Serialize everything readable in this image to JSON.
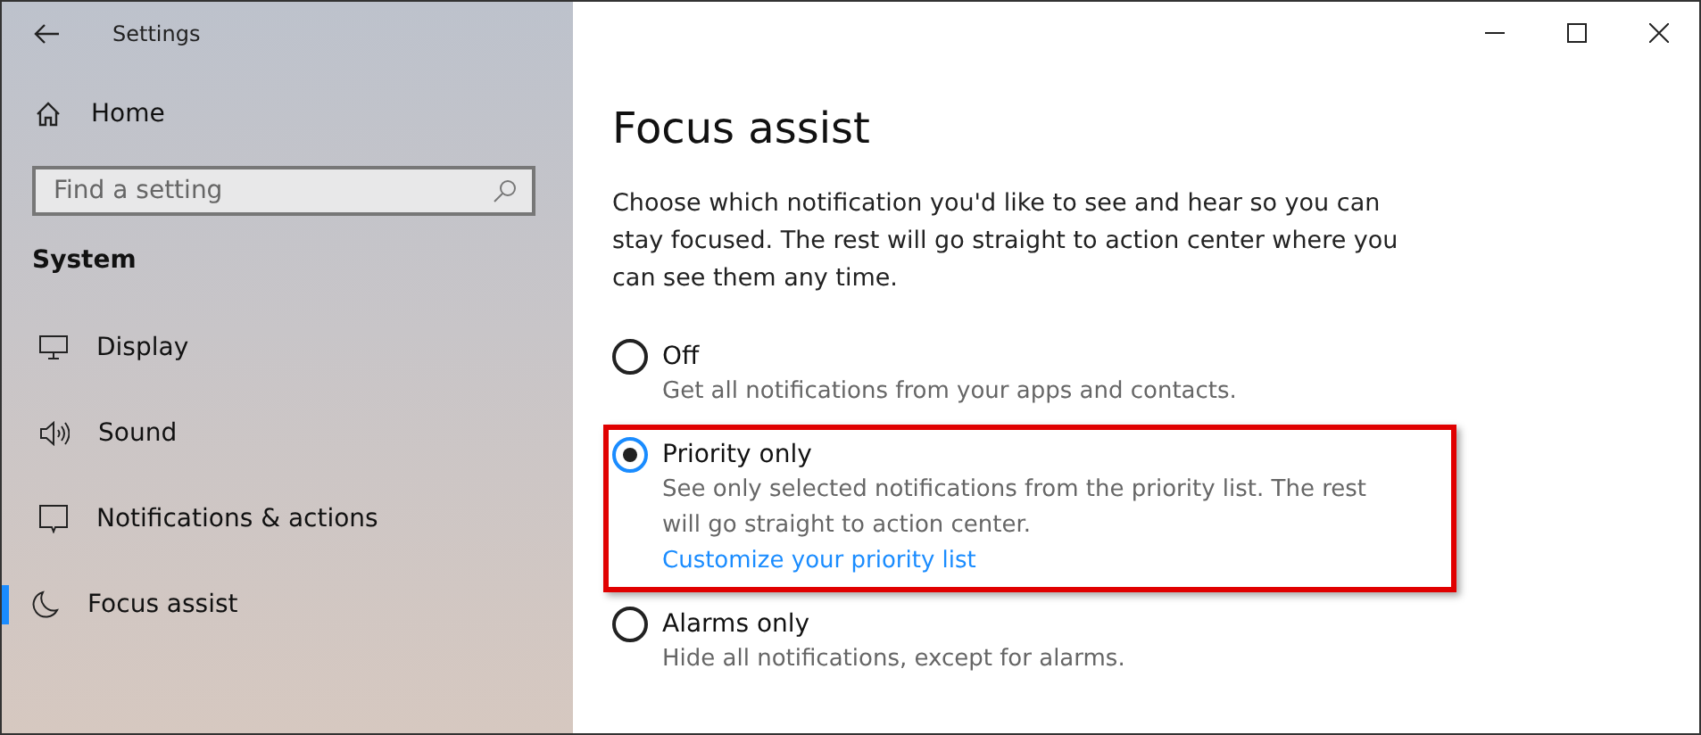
{
  "window": {
    "title": "Settings"
  },
  "sidebar": {
    "home": "Home",
    "search": {
      "placeholder": "Find a setting"
    },
    "section": "System",
    "items": [
      {
        "label": "Display",
        "kind": "display",
        "selected": false
      },
      {
        "label": "Sound",
        "kind": "sound",
        "selected": false
      },
      {
        "label": "Notifications & actions",
        "kind": "notifications",
        "selected": false
      },
      {
        "label": "Focus assist",
        "kind": "focus",
        "selected": true
      }
    ]
  },
  "page": {
    "title": "Focus assist",
    "description": "Choose which notification you'd like to see and hear so you can stay focused. The rest will go straight to action center where you can see them any time.",
    "options": [
      {
        "label": "Off",
        "description": "Get all notifications from your apps and contacts.",
        "selected": false,
        "highlighted": false
      },
      {
        "label": "Priority only",
        "description": "See only selected notifications from the priority list. The rest will go straight to action center.",
        "link": "Customize your priority list",
        "selected": true,
        "highlighted": true
      },
      {
        "label": "Alarms only",
        "description": "Hide all notifications, except for alarms.",
        "selected": false,
        "highlighted": false
      }
    ]
  }
}
